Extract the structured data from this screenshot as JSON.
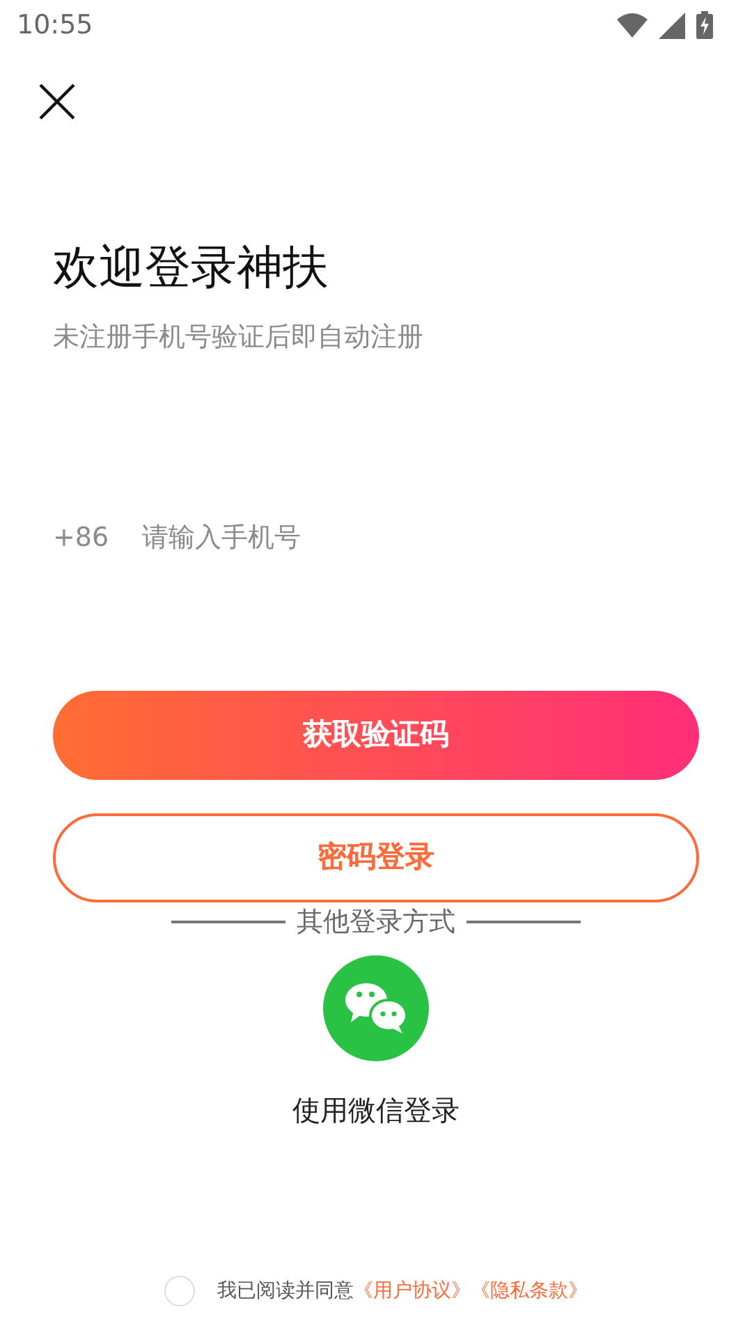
{
  "status_bar": {
    "time": "10:55"
  },
  "title": "欢迎登录神扶",
  "subtitle": "未注册手机号验证后即自动注册",
  "phone": {
    "prefix": "+86",
    "placeholder": "请输入手机号"
  },
  "primary_button": "获取验证码",
  "secondary_button": "密码登录",
  "other_methods_label": "其他登录方式",
  "wechat_label": "使用微信登录",
  "agreement": {
    "checked": false,
    "text": "我已阅读并同意",
    "links": [
      "《用户协议》",
      "《隐私条款》"
    ]
  }
}
